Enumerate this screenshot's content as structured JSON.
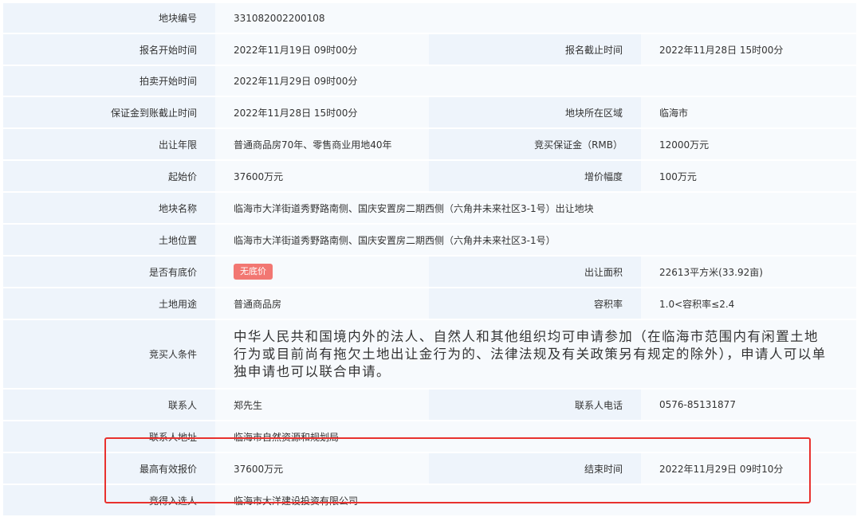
{
  "rows": {
    "parcel_no": {
      "label": "地块编号",
      "value": "331082002200108"
    },
    "reg_start": {
      "label": "报名开始时间",
      "value": "2022年11月19日 09时00分"
    },
    "reg_end": {
      "label": "报名截止时间",
      "value": "2022年11月28日 15时00分"
    },
    "auction_start": {
      "label": "拍卖开始时间",
      "value": "2022年11月29日 09时00分"
    },
    "deposit_deadline": {
      "label": "保证金到账截止时间",
      "value": "2022年11月28日 15时00分"
    },
    "district": {
      "label": "地块所在区域",
      "value": "临海市"
    },
    "term": {
      "label": "出让年限",
      "value": "普通商品房70年、零售商业用地40年"
    },
    "deposit": {
      "label": "竞买保证金（RMB）",
      "value": "12000万元"
    },
    "start_price": {
      "label": "起始价",
      "value": "37600万元"
    },
    "increment": {
      "label": "增价幅度",
      "value": "100万元"
    },
    "parcel_name": {
      "label": "地块名称",
      "value": "临海市大洋街道秀野路南侧、国庆安置房二期西侧（六角井未来社区3-1号）出让地块"
    },
    "location": {
      "label": "土地位置",
      "value": "临海市大洋街道秀野路南侧、国庆安置房二期西侧（六角井未来社区3-1号）"
    },
    "reserve": {
      "label": "是否有底价",
      "value": "无底价"
    },
    "area": {
      "label": "出让面积",
      "value": "22613平方米(33.92亩)"
    },
    "land_use": {
      "label": "土地用途",
      "value": "普通商品房"
    },
    "plot_ratio": {
      "label": "容积率",
      "value": "1.0<容积率≤2.4"
    },
    "bidder_conditions": {
      "label": "竞买人条件",
      "value": "中华人民共和国境内外的法人、自然人和其他组织均可申请参加（在临海市范围内有闲置土地行为或目前尚有拖欠土地出让金行为的、法律法规及有关政策另有规定的除外），申请人可以单独申请也可以联合申请。"
    },
    "contact": {
      "label": "联系人",
      "value": "郑先生"
    },
    "contact_phone": {
      "label": "联系人电话",
      "value": "0576-85131877"
    },
    "contact_address": {
      "label": "联系人地址",
      "value": "临海市自然资源和规划局"
    },
    "top_bid": {
      "label": "最高有效报价",
      "value": "37600万元"
    },
    "end_time": {
      "label": "结束时间",
      "value": "2022年11月29日 09时10分"
    },
    "winner": {
      "label": "竞得入选人",
      "value": "临海市大洋建设投资有限公司"
    }
  },
  "colors": {
    "label_bg": "#eef4fb",
    "value_bg": "#f7fafd",
    "badge_bg": "#f27772",
    "highlight_border": "#e8312e"
  }
}
